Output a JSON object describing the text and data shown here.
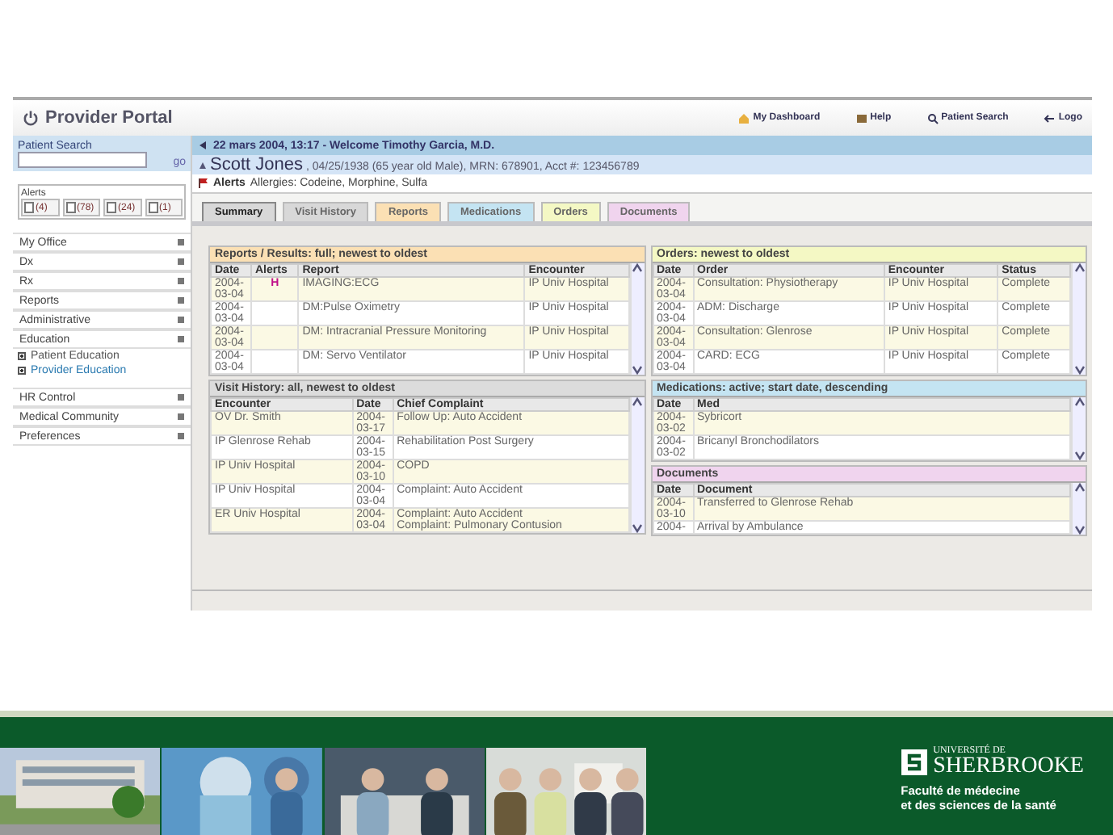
{
  "header": {
    "title": "Provider Portal",
    "links": [
      "My Dashboard",
      "Help",
      "Patient Search",
      "Logo"
    ]
  },
  "welcome": "22 mars 2004, 13:17 - Welcome Timothy Garcia, M.D.",
  "patient_search": {
    "label": "Patient Search",
    "go": "go"
  },
  "alerts_box": {
    "label": "Alerts",
    "counts": [
      "(4)",
      "(78)",
      "(24)",
      "(1)"
    ]
  },
  "nav": [
    {
      "label": "My Office"
    },
    {
      "label": "Dx"
    },
    {
      "label": "Rx"
    },
    {
      "label": "Reports"
    },
    {
      "label": "Administrative"
    },
    {
      "label": "Education",
      "children": [
        {
          "label": "Patient Education",
          "selected": false
        },
        {
          "label": "Provider Education",
          "selected": true
        }
      ]
    },
    {
      "label": "HR Control"
    },
    {
      "label": "Medical Community"
    },
    {
      "label": "Preferences"
    }
  ],
  "patient": {
    "name": "Scott Jones",
    "details": ", 04/25/1938 (65 year old Male), MRN: 678901, Acct #: 123456789"
  },
  "alerts": {
    "label": "Alerts",
    "text": "Allergies: Codeine, Morphine, Sulfa"
  },
  "tabs": [
    {
      "label": "Summary",
      "selected": true,
      "color": "#d8d8d8"
    },
    {
      "label": "Visit History",
      "selected": false,
      "color": "#d8d8d8"
    },
    {
      "label": "Reports",
      "selected": false,
      "color": "#fbe0b4"
    },
    {
      "label": "Medications",
      "selected": false,
      "color": "#c4e4f2"
    },
    {
      "label": "Orders",
      "selected": false,
      "color": "#f4f8c4"
    },
    {
      "label": "Documents",
      "selected": false,
      "color": "#f0d4ee"
    }
  ],
  "left_panels": [
    {
      "title": "Reports / Results: full; newest to oldest",
      "color": "#fbe0b4",
      "columns": [
        {
          "label": "Date",
          "kind": "date"
        },
        {
          "label": "Alerts",
          "kind": "alert"
        },
        {
          "label": "Report",
          "kind": "text"
        },
        {
          "label": "Encounter",
          "kind": "text"
        }
      ],
      "rows": [
        [
          "2004-03-04",
          "H",
          "IMAGING:ECG",
          "IP Univ Hospital"
        ],
        [
          "2004-03-04",
          "",
          "DM:Pulse Oximetry",
          "IP Univ Hospital"
        ],
        [
          "2004-03-04",
          "",
          "DM: Intracranial Pressure Monitoring",
          "IP Univ Hospital"
        ],
        [
          "2004-03-04",
          "",
          "DM: Servo Ventilator",
          "IP Univ Hospital"
        ]
      ]
    },
    {
      "title": "Visit History: all, newest to oldest",
      "color": "#dcdcdc",
      "columns": [
        {
          "label": "Encounter",
          "kind": "text"
        },
        {
          "label": "Date",
          "kind": "date"
        },
        {
          "label": "Chief Complaint",
          "kind": "text"
        }
      ],
      "rows": [
        [
          "OV Dr. Smith",
          "2004-03-17",
          "Follow Up: Auto Accident"
        ],
        [
          "IP Glenrose Rehab",
          "2004-03-15",
          "Rehabilitation Post Surgery"
        ],
        [
          "IP Univ Hospital",
          "2004-03-10",
          "COPD"
        ],
        [
          "IP Univ Hospital",
          "2004-03-04",
          "Complaint: Auto Accident"
        ],
        [
          "ER Univ Hospital",
          "2004-03-04",
          "Complaint: Auto Accident\nComplaint: Pulmonary Contusion"
        ]
      ]
    }
  ],
  "right_panels": [
    {
      "title": "Orders: newest to oldest",
      "color": "#f4f8c4",
      "columns": [
        {
          "label": "Date",
          "kind": "date"
        },
        {
          "label": "Order",
          "kind": "text"
        },
        {
          "label": "Encounter",
          "kind": "text"
        },
        {
          "label": "Status",
          "kind": "text"
        }
      ],
      "rows": [
        [
          "2004-03-04",
          "Consultation: Physiotherapy",
          "IP Univ Hospital",
          "Complete"
        ],
        [
          "2004-03-04",
          "ADM: Discharge",
          "IP Univ Hospital",
          "Complete"
        ],
        [
          "2004-03-04",
          "Consultation: Glenrose",
          "IP Univ Hospital",
          "Complete"
        ],
        [
          "2004-03-04",
          "CARD: ECG",
          "IP Univ Hospital",
          "Complete"
        ]
      ]
    },
    {
      "title": "Medications: active; start date, descending",
      "color": "#c4e4f2",
      "columns": [
        {
          "label": "Date",
          "kind": "date"
        },
        {
          "label": "Med",
          "kind": "text"
        }
      ],
      "rows": [
        [
          "2004-03-02",
          "Sybricort"
        ],
        [
          "2004-03-02",
          "Bricanyl Bronchodilators"
        ]
      ]
    },
    {
      "title": "Documents",
      "color": "#f0d4ee",
      "columns": [
        {
          "label": "Date",
          "kind": "date"
        },
        {
          "label": "Document",
          "kind": "text"
        }
      ],
      "rows": [
        [
          "2004-03-10",
          "Transferred to Glenrose Rehab"
        ],
        [
          "2004-",
          "Arrival by Ambulance"
        ]
      ]
    }
  ],
  "footer": {
    "university": [
      "UNIVERSITÉ DE",
      "SHERBROOKE"
    ],
    "faculty": [
      "Faculté de médecine",
      "et des sciences de la santé"
    ],
    "photos": [
      {
        "kind": "picture"
      },
      {
        "kind": "picture"
      },
      {
        "kind": "picture"
      },
      {
        "kind": "picture"
      }
    ]
  }
}
